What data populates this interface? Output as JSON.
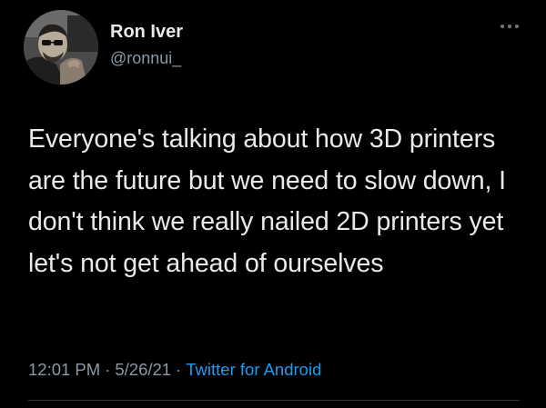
{
  "author": {
    "display_name": "Ron Iver",
    "handle": "@ronnui_",
    "avatar_icon": "avatar-photo"
  },
  "more_icon": "more-horizontal-icon",
  "tweet": {
    "text": "Everyone's talking about how 3D printers are the future but we need to slow down, I don't think we really nailed 2D printers yet let's not get ahead of ourselves",
    "time": "12:01 PM",
    "separator": "·",
    "date": "5/26/21",
    "source": "Twitter for Android"
  },
  "colors": {
    "background": "#000000",
    "text": "#e7e9ea",
    "secondary": "#8b98a5",
    "link": "#1d9bf0"
  }
}
